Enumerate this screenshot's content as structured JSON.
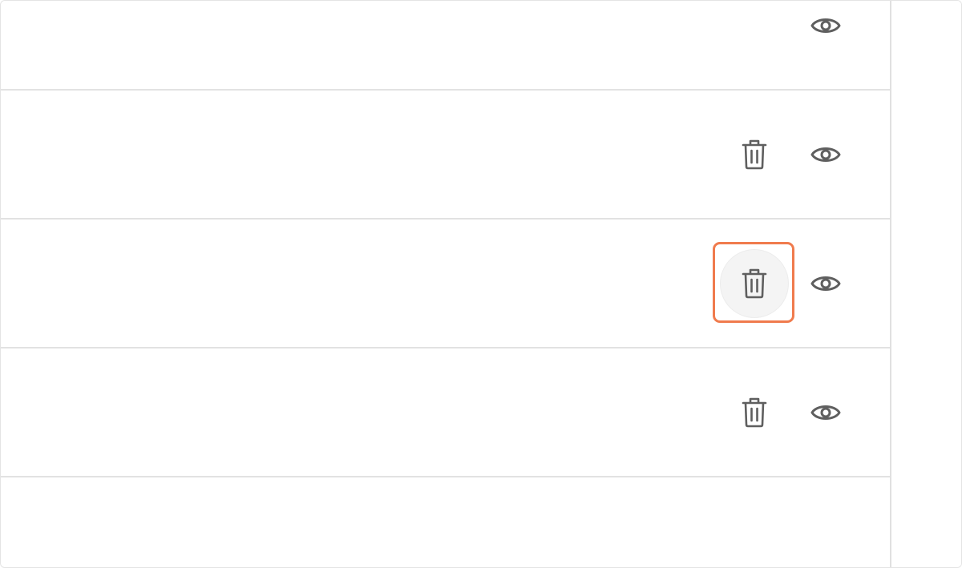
{
  "table": {
    "rows": [
      {
        "actions": [
          "view"
        ]
      },
      {
        "actions": [
          "delete",
          "view"
        ]
      },
      {
        "actions": [
          "delete",
          "view"
        ],
        "delete_state": "hovered-focused"
      },
      {
        "actions": [
          "delete",
          "view"
        ]
      },
      {
        "actions": []
      }
    ]
  },
  "icons": {
    "view": "eye-icon",
    "delete": "trash-icon"
  },
  "colors": {
    "icon": "#5f5f5f",
    "divider": "#e2e2e2",
    "focus_ring": "#f07b4d",
    "hover_bg": "#f4f4f4"
  }
}
